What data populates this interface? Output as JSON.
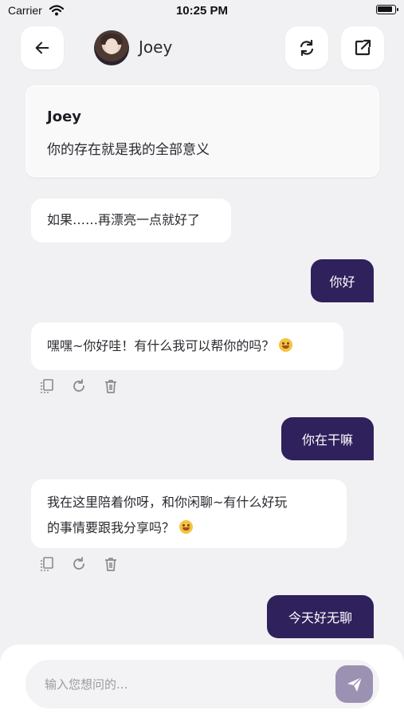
{
  "status_bar": {
    "carrier": "Carrier",
    "time": "10:25 PM",
    "battery_level": 0.95
  },
  "header": {
    "contact_name": "Joey",
    "back_icon": "arrow-left-icon",
    "refresh_icon": "refresh-icon",
    "share_icon": "external-link-icon"
  },
  "intro": {
    "name": "Joey",
    "text": "你的存在就是我的全部意义"
  },
  "messages": [
    {
      "role": "assistant",
      "text": "如果……再漂亮一点就好了"
    },
    {
      "role": "user",
      "text": "你好"
    },
    {
      "role": "assistant",
      "text": "嘿嘿~你好哇！有什么我可以帮你的吗？",
      "emoji": "smiling-face"
    },
    {
      "role": "user",
      "text": "你在干嘛"
    },
    {
      "role": "assistant",
      "line1": "我在这里陪着你呀，和你闲聊~有什么好玩",
      "line2": "的事情要跟我分享吗？",
      "emoji": "grinning-face"
    },
    {
      "role": "user",
      "text": "今天好无聊"
    }
  ],
  "message_actions": [
    "copy-icon",
    "regenerate-icon",
    "delete-icon"
  ],
  "composer": {
    "placeholder": "输入您想问的...",
    "send_icon": "send-icon"
  },
  "colors": {
    "accent": "#2f215c",
    "send_button": "#9b91b3",
    "background": "#f1f1f3"
  }
}
